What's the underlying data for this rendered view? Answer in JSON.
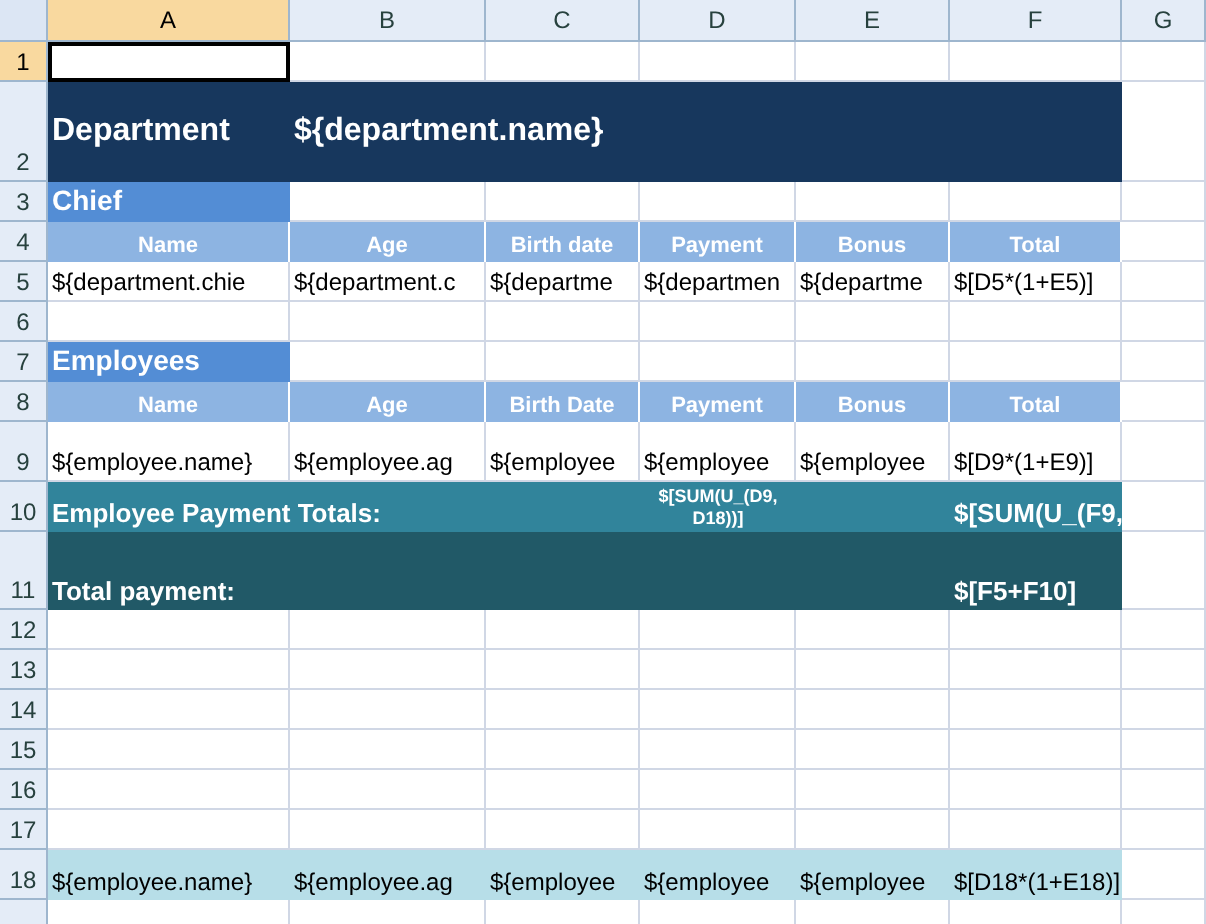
{
  "columns": [
    {
      "label": "A",
      "selected": true
    },
    {
      "label": "B",
      "selected": false
    },
    {
      "label": "C",
      "selected": false
    },
    {
      "label": "D",
      "selected": false
    },
    {
      "label": "E",
      "selected": false
    },
    {
      "label": "F",
      "selected": false
    },
    {
      "label": "G",
      "selected": false
    }
  ],
  "rows": [
    {
      "number": "1",
      "selected": true,
      "kind": "blank",
      "cells": []
    },
    {
      "number": "2",
      "selected": false,
      "kind": "title",
      "cells": [
        "Department",
        "${department.name}"
      ]
    },
    {
      "number": "3",
      "selected": false,
      "kind": "section",
      "cells": [
        "Chief"
      ]
    },
    {
      "number": "4",
      "selected": false,
      "kind": "header",
      "cells": [
        "Name",
        "Age",
        "Birth date",
        "Payment",
        "Bonus",
        "Total"
      ]
    },
    {
      "number": "5",
      "selected": false,
      "kind": "data",
      "cells": [
        "${department.chie",
        "${department.c",
        "${departme",
        "${departmen",
        "${departme",
        "$[D5*(1+E5)]"
      ]
    },
    {
      "number": "6",
      "selected": false,
      "kind": "blank",
      "cells": []
    },
    {
      "number": "7",
      "selected": false,
      "kind": "section",
      "cells": [
        "Employees"
      ]
    },
    {
      "number": "8",
      "selected": false,
      "kind": "header",
      "cells": [
        "Name",
        "Age",
        "Birth Date",
        "Payment",
        "Bonus",
        "Total"
      ]
    },
    {
      "number": "9",
      "selected": false,
      "kind": "tall-data",
      "cells": [
        "${employee.name}",
        "${employee.ag",
        "${employee",
        "${employee",
        "${employee",
        "$[D9*(1+E9)]"
      ]
    },
    {
      "number": "10",
      "selected": false,
      "kind": "subtotal",
      "cells": [
        "Employee Payment Totals:",
        "$[SUM(U_(D9, D18))]",
        "$[SUM(U_(F9,"
      ]
    },
    {
      "number": "11",
      "selected": false,
      "kind": "total",
      "cells": [
        "Total payment:",
        "$[F5+F10]"
      ]
    },
    {
      "number": "12",
      "selected": false,
      "kind": "blank",
      "cells": []
    },
    {
      "number": "13",
      "selected": false,
      "kind": "blank",
      "cells": []
    },
    {
      "number": "14",
      "selected": false,
      "kind": "blank",
      "cells": []
    },
    {
      "number": "15",
      "selected": false,
      "kind": "blank",
      "cells": []
    },
    {
      "number": "16",
      "selected": false,
      "kind": "blank",
      "cells": []
    },
    {
      "number": "17",
      "selected": false,
      "kind": "blank",
      "cells": []
    },
    {
      "number": "18",
      "selected": false,
      "kind": "band",
      "cells": [
        "${employee.name}",
        "${employee.ag",
        "${employee",
        "${employee",
        "${employee",
        "$[D18*(1+E18)]"
      ]
    }
  ]
}
